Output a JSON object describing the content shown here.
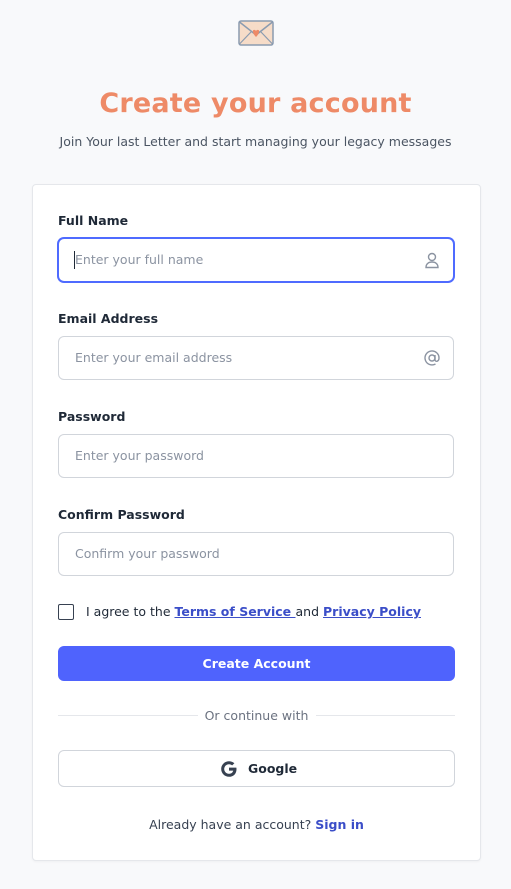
{
  "header": {
    "logo_icon": "envelope-icon",
    "title": "Create your account",
    "subtitle": "Join Your last Letter and start managing your legacy messages"
  },
  "form": {
    "full_name": {
      "label": "Full Name",
      "placeholder": "Enter your full name",
      "value": "",
      "icon": "user-icon"
    },
    "email": {
      "label": "Email Address",
      "placeholder": "Enter your email address",
      "value": "",
      "icon": "at-sign-icon"
    },
    "password": {
      "label": "Password",
      "placeholder": "Enter your password",
      "value": ""
    },
    "confirm_password": {
      "label": "Confirm Password",
      "placeholder": "Confirm your password",
      "value": ""
    },
    "agree": {
      "prefix": "I agree to the ",
      "terms_link": "Terms of Service ",
      "middle": "and ",
      "privacy_link": "Privacy Policy",
      "checked": false
    },
    "submit_label": "Create Account",
    "divider_text": "Or continue with",
    "google_label": "Google",
    "signin_prompt": "Already have an account?",
    "signin_link": "Sign in"
  },
  "colors": {
    "accent": "#ee8a67",
    "primary": "#4f63fd",
    "link": "#3b4ec8",
    "background": "#f8f9fb"
  }
}
